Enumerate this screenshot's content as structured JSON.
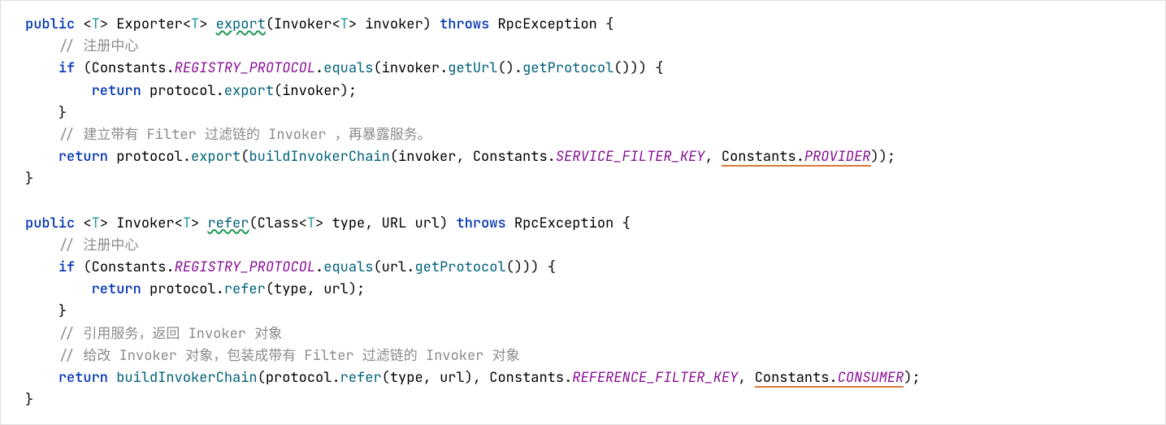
{
  "code": {
    "method1": {
      "kw_public": "public",
      "lt1": "<",
      "t1": "T",
      "gt1": ">",
      "sp1": " ",
      "ret_type": "Exporter",
      "lt2": "<",
      "t2": "T",
      "gt2": ">",
      "sp2": " ",
      "name": "export",
      "lp": "(",
      "param_type": "Invoker",
      "lt3": "<",
      "t3": "T",
      "gt3": ">",
      "sp3": " ",
      "param_name": "invoker",
      "rp": ")",
      "sp4": " ",
      "kw_throws": "throws",
      "sp5": " ",
      "exc": "RpcException",
      "sp6": " ",
      "lb": "{",
      "c1": "// 注册中心",
      "if_kw": "if",
      "if_lp": " (",
      "const_cls": "Constants",
      "dot1": ".",
      "reg_proto": "REGISTRY_PROTOCOL",
      "dot2": ".",
      "equals": "equals",
      "eq_lp": "(",
      "inv": "invoker",
      "dot3": ".",
      "geturl": "getUrl",
      "geturl_p": "()",
      "dot4": ".",
      "getproto": "getProtocol",
      "getproto_p": "()))",
      "sp7": " ",
      "if_lb": "{",
      "ret1_kw": "return",
      "sp8": " ",
      "proto1": "protocol",
      "dot5": ".",
      "export1": "export",
      "export1_p": "(",
      "inv2": "invoker",
      "export1_rp": ");",
      "if_rb": "}",
      "c2": "// 建立带有 Filter 过滤链的 Invoker ，再暴露服务。",
      "ret2_kw": "return",
      "sp9": " ",
      "proto2": "protocol",
      "dot6": ".",
      "export2": "export",
      "export2_lp": "(",
      "build1": "buildInvokerChain",
      "build1_lp": "(",
      "inv3": "invoker",
      "comma1": ", ",
      "const2": "Constants",
      "dot7": ".",
      "sfk": "SERVICE_FILTER_KEY",
      "comma2": ", ",
      "const3": "Constants",
      "dot8": ".",
      "provider": "PROVIDER",
      "export2_rp": "));",
      "rb": "}"
    },
    "method2": {
      "kw_public": "public",
      "lt1": "<",
      "t1": "T",
      "gt1": ">",
      "sp1": " ",
      "ret_type": "Invoker",
      "lt2": "<",
      "t2": "T",
      "gt2": ">",
      "sp2": " ",
      "name": "refer",
      "lp": "(",
      "p1_type": "Class",
      "lt3": "<",
      "t3": "T",
      "gt3": ">",
      "sp3": " ",
      "p1_name": "type",
      "comma0": ", ",
      "p2_type": "URL",
      "sp3b": " ",
      "p2_name": "url",
      "rp": ")",
      "sp4": " ",
      "kw_throws": "throws",
      "sp5": " ",
      "exc": "RpcException",
      "sp6": " ",
      "lb": "{",
      "c1": "// 注册中心",
      "if_kw": "if",
      "if_lp": " (",
      "const_cls": "Constants",
      "dot1": ".",
      "reg_proto": "REGISTRY_PROTOCOL",
      "dot2": ".",
      "equals": "equals",
      "eq_lp": "(",
      "url1": "url",
      "dot3": ".",
      "getproto": "getProtocol",
      "getproto_p": "()))",
      "sp7": " ",
      "if_lb": "{",
      "ret1_kw": "return",
      "sp8": " ",
      "proto1": "protocol",
      "dot5": ".",
      "refer1": "refer",
      "refer1_p": "(",
      "type1": "type",
      "comma_r1": ", ",
      "url2": "url",
      "refer1_rp": ");",
      "if_rb": "}",
      "c2": "// 引用服务，返回 Invoker 对象",
      "c3": "// 给改 Invoker 对象，包装成带有 Filter 过滤链的 Invoker 对象",
      "ret2_kw": "return",
      "sp9": " ",
      "build": "buildInvokerChain",
      "build_lp": "(",
      "proto2": "protocol",
      "dot6": ".",
      "refer2": "refer",
      "refer2_lp": "(",
      "type2": "type",
      "comma_r2": ", ",
      "url3": "url",
      "refer2_rp": ")",
      "comma1": ", ",
      "const2": "Constants",
      "dot7": ".",
      "rfk": "REFERENCE_FILTER_KEY",
      "comma2": ", ",
      "const3": "Constants",
      "dot8": ".",
      "consumer": "CONSUMER",
      "build_rp": ");",
      "rb": "}"
    }
  }
}
